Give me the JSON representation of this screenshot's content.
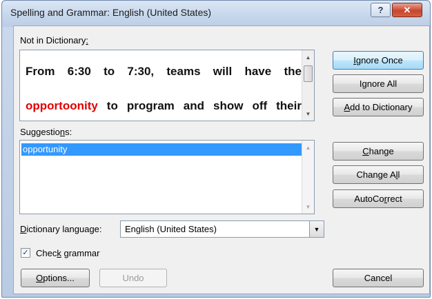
{
  "window": {
    "title": "Spelling and Grammar: English (United States)",
    "help_label": "?",
    "close_label": "✕"
  },
  "not_in_dictionary": {
    "label_pre": "Not in Dictionary",
    "label_mnemonic": ":",
    "line1_words": [
      "From",
      "6:30",
      "to",
      "7:30,",
      "teams",
      "will",
      "have",
      "the"
    ],
    "error_word": "opportoonity",
    "line2_words": [
      "to",
      "program",
      "and",
      "show",
      "off",
      "their"
    ]
  },
  "suggestions": {
    "label_pre": "Suggestio",
    "label_mnemonic": "n",
    "label_post": "s:",
    "items": [
      "opportunity"
    ]
  },
  "buttons": {
    "ignore_once": {
      "mn": "I",
      "rest": "gnore Once"
    },
    "ignore_all": {
      "pre": "I",
      "mn": "g",
      "rest": "nore All"
    },
    "add_to_dictionary": {
      "mn": "A",
      "rest": "dd to Dictionary"
    },
    "change": {
      "mn": "C",
      "rest": "hange"
    },
    "change_all": {
      "pre": "Change A",
      "mn": "l",
      "rest": "l"
    },
    "autocorrect": {
      "pre": "AutoCo",
      "mn": "r",
      "rest": "rect"
    },
    "options": {
      "mn": "O",
      "rest": "ptions..."
    },
    "undo": "Undo",
    "cancel": "Cancel"
  },
  "dictionary_language": {
    "label_pre": "",
    "label_mnemonic": "D",
    "label_post": "ictionary language:",
    "value": "English (United States)"
  },
  "check_grammar": {
    "label_pre": "Chec",
    "label_mnemonic": "k",
    "label_post": " grammar",
    "checked": true,
    "mark": "✓"
  }
}
